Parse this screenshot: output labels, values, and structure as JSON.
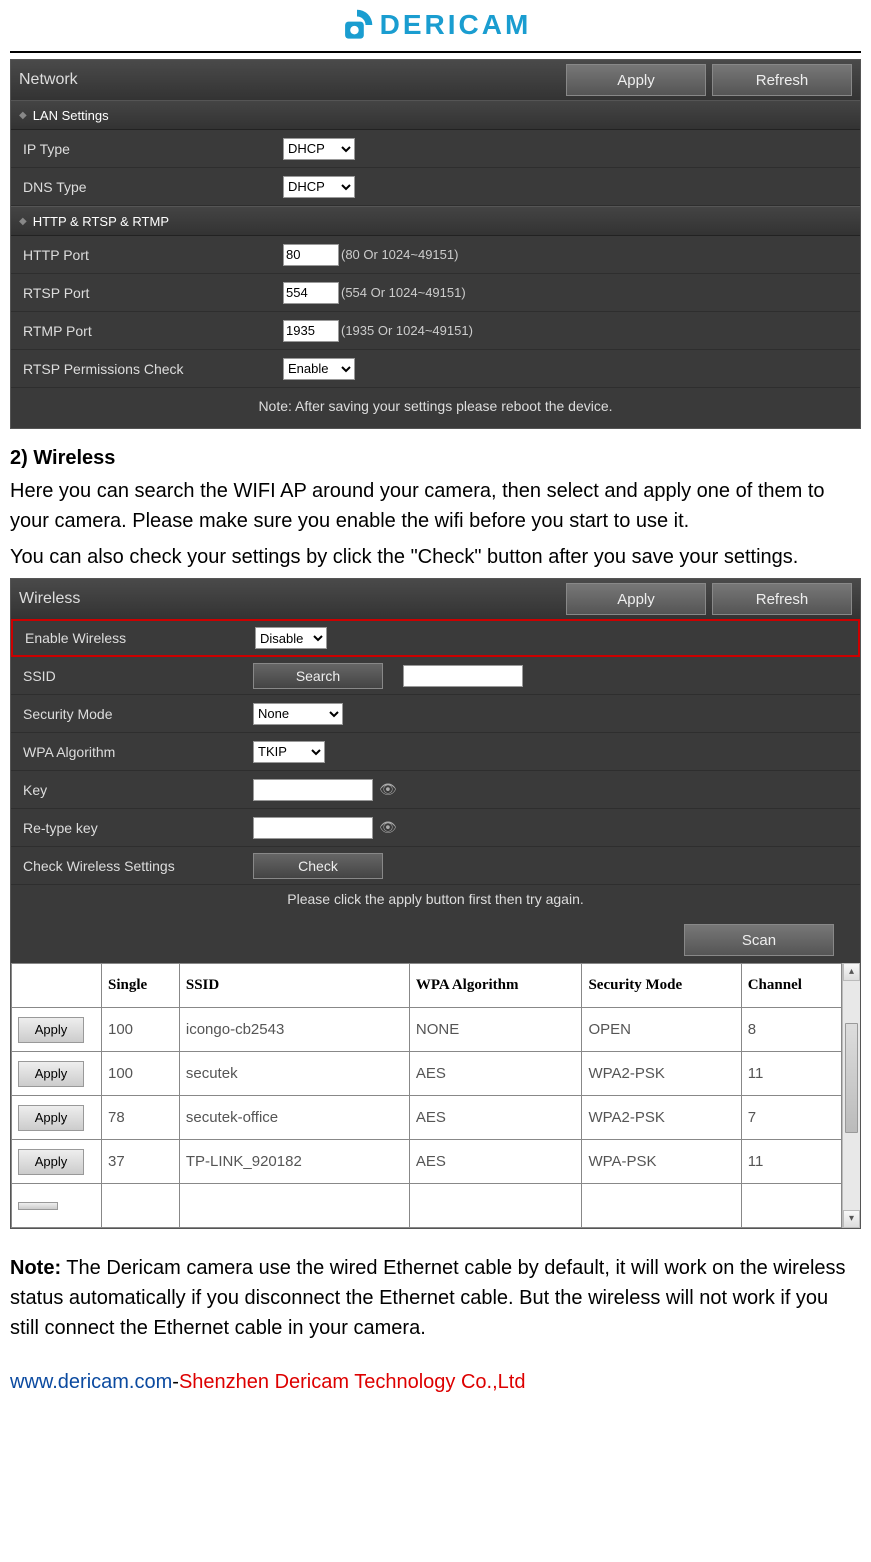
{
  "logo": {
    "text": "DERICAM"
  },
  "network_panel": {
    "title": "Network",
    "apply": "Apply",
    "refresh": "Refresh",
    "lan_header": "LAN Settings",
    "ip_type_label": "IP Type",
    "ip_type_value": "DHCP",
    "dns_type_label": "DNS Type",
    "dns_type_value": "DHCP",
    "ports_header": "HTTP & RTSP & RTMP",
    "http_port_label": "HTTP Port",
    "http_port_value": "80",
    "http_port_hint": "(80 Or 1024~49151)",
    "rtsp_port_label": "RTSP Port",
    "rtsp_port_value": "554",
    "rtsp_port_hint": "(554 Or 1024~49151)",
    "rtmp_port_label": "RTMP Port",
    "rtmp_port_value": "1935",
    "rtmp_port_hint": "(1935 Or 1024~49151)",
    "rtsp_perm_label": "RTSP Permissions Check",
    "rtsp_perm_value": "Enable",
    "note": "Note: After saving your settings please reboot the device."
  },
  "wireless_section": {
    "heading": "2) Wireless",
    "para1": "Here you can search the WIFI AP around your camera, then select and apply one of them to your camera. Please make sure you enable the wifi before you start to use it.",
    "para2": "You can also check your settings by click the \"Check\" button after you save your settings."
  },
  "wireless_panel": {
    "title": "Wireless",
    "apply": "Apply",
    "refresh": "Refresh",
    "enable_label": "Enable Wireless",
    "enable_value": "Disable",
    "ssid_label": "SSID",
    "search_btn": "Search",
    "ssid_value": "",
    "secmode_label": "Security Mode",
    "secmode_value": "None",
    "wpa_label": "WPA Algorithm",
    "wpa_value": "TKIP",
    "key_label": "Key",
    "key_value": "",
    "rekey_label": "Re-type key",
    "rekey_value": "",
    "check_label": "Check Wireless Settings",
    "check_btn": "Check",
    "msg": "Please click the apply button first then try again.",
    "scan": "Scan",
    "table": {
      "headers": {
        "single": "Single",
        "ssid": "SSID",
        "wpa": "WPA Algorithm",
        "sec": "Security Mode",
        "chan": "Channel"
      },
      "rows": [
        {
          "apply": "Apply",
          "single": "100",
          "ssid": "icongo-cb2543",
          "wpa": "NONE",
          "sec": "OPEN",
          "chan": "8"
        },
        {
          "apply": "Apply",
          "single": "100",
          "ssid": "secutek",
          "wpa": "AES",
          "sec": "WPA2-PSK",
          "chan": "11"
        },
        {
          "apply": "Apply",
          "single": "78",
          "ssid": "secutek-office",
          "wpa": "AES",
          "sec": "WPA2-PSK",
          "chan": "7"
        },
        {
          "apply": "Apply",
          "single": "37",
          "ssid": "TP-LINK_920182",
          "wpa": "AES",
          "sec": "WPA-PSK",
          "chan": "11"
        }
      ]
    }
  },
  "note_section": {
    "bold": "Note:",
    "text": " The Dericam camera use the wired Ethernet cable by default, it will work on the wireless status automatically if you disconnect the Ethernet cable. But the wireless will not work if you still connect the Ethernet cable in your camera."
  },
  "footer": {
    "link": "www.dericam.com",
    "sep": "-",
    "company": "Shenzhen Dericam Technology Co.,Ltd"
  }
}
